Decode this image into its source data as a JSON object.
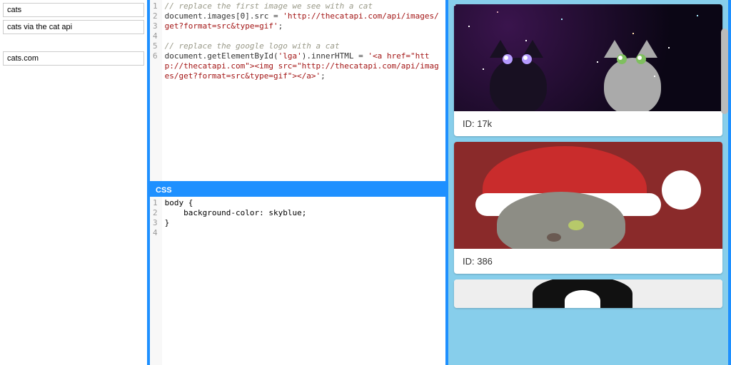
{
  "sidebar": {
    "items": [
      {
        "label": "cats"
      },
      {
        "label": "cats via the cat api"
      },
      {
        "label": "cats.com"
      }
    ]
  },
  "editors": {
    "js": {
      "lines": [
        "1",
        "2",
        "3",
        "4",
        "5",
        "6"
      ],
      "comment1": "// replace the first image we see with a cat",
      "line2a": "document.images[0].src = ",
      "line2b": "'http://thecatapi.com/api/images/get?format=src&type=gif'",
      "line2c": ";",
      "comment2": "// replace the google logo with a cat",
      "line5a": "document.getElementById(",
      "line5b": "'lga'",
      "line5c": ").innerHTML = ",
      "line5d": "'<a href=\"http://thecatapi.com\"><img src=\"http://thecatapi.com/api/images/get?format=src&type=gif\"></a>'",
      "line5e": ";"
    },
    "css": {
      "title": "CSS",
      "lines": [
        "1",
        "2",
        "3",
        "4"
      ],
      "l1": "body {",
      "l2": "    background-color: skyblue;",
      "l3": "}",
      "l4": ""
    }
  },
  "preview": {
    "cards": [
      {
        "label": "ID: 17k"
      },
      {
        "label": "ID: 386"
      }
    ]
  }
}
